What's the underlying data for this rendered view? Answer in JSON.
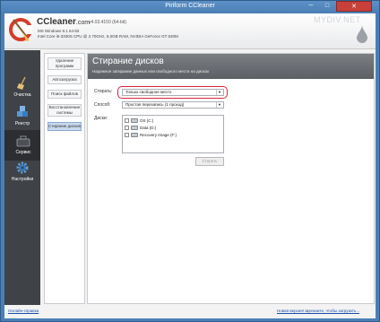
{
  "window": {
    "title": "Piriform CCleaner",
    "minimize": "─",
    "maximize": "□",
    "close": "✕"
  },
  "header": {
    "app_name": "CCleaner",
    "app_suffix": ".com",
    "version": "v4.03.4150 (64-bit)",
    "sysinfo_line1": "MS Windows 8.1 64-bit",
    "sysinfo_line2": "Intel Core i5-3330S CPU @ 2.70GHz, 6,0GB RAM, NVIDIA GeForce GT 630M",
    "watermark": "MYDIV.NET"
  },
  "leftnav": {
    "items": [
      {
        "label": "Очистка",
        "icon": "broom-icon"
      },
      {
        "label": "Реестр",
        "icon": "registry-cubes-icon"
      },
      {
        "label": "Сервис",
        "icon": "toolbox-icon",
        "active": true
      },
      {
        "label": "Настройки",
        "icon": "gear-icon"
      }
    ]
  },
  "subnav": {
    "items": [
      {
        "label": "Удаление программ"
      },
      {
        "label": "Автозагрузка"
      },
      {
        "label": "Поиск файлов"
      },
      {
        "label": "Восстановление системы"
      },
      {
        "label": "Стирание дисков",
        "active": true
      }
    ]
  },
  "content": {
    "title": "Стирание дисков",
    "subtitle": "Надежное затирание данных или свободного места на дисках",
    "wipe_label": "Стирать:",
    "wipe_value": "Только свободное место",
    "method_label": "Способ:",
    "method_value": "Простая перезапись (1 проход)",
    "disks_label": "Диски:",
    "disks": [
      {
        "name": "OS (C:)",
        "checked": false
      },
      {
        "name": "Data (D:)",
        "checked": false
      },
      {
        "name": "Recovery Image (F:)",
        "checked": false
      }
    ],
    "wipe_button": "Стереть"
  },
  "footer": {
    "help_link": "Онлайн-справка",
    "update_link": "Новая версия! Щелкните, чтобы загрузить..."
  },
  "colors": {
    "titlebar": "#4a7fb5",
    "nav_bg": "#3f4246",
    "highlight": "#d9263b",
    "link": "#1b4fa8"
  }
}
